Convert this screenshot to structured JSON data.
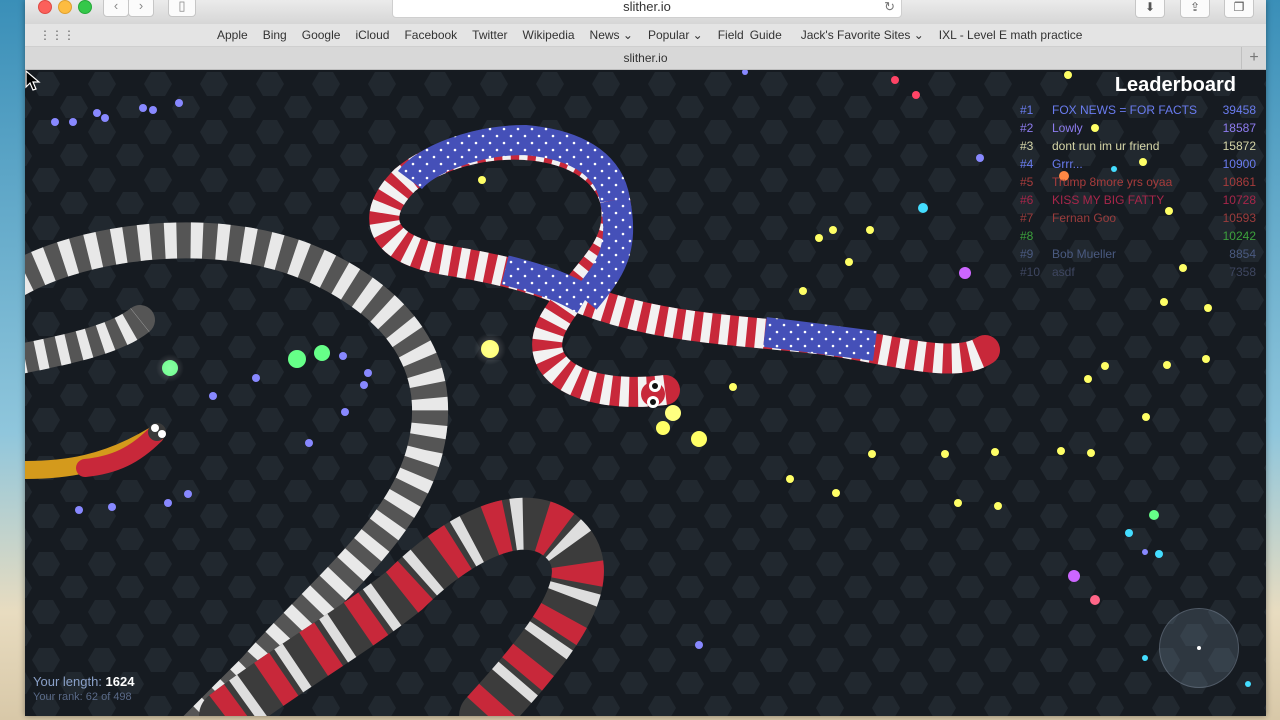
{
  "window": {
    "url": "slither.io",
    "tab_title": "slither.io",
    "colors": {
      "close": "#fc605b",
      "minimize": "#fdbc40",
      "zoom": "#34c84a"
    }
  },
  "toolbar": {
    "back_icon": "chevron-left-icon",
    "forward_icon": "chevron-right-icon",
    "sidebar_icon": "sidebar-icon",
    "reload_icon": "reload-icon",
    "downloads_icon": "download-icon",
    "share_icon": "share-icon",
    "tabs_icon": "tabs-icon"
  },
  "bookmarks": {
    "grid_icon": "grid-icon",
    "items": [
      {
        "label": "Apple"
      },
      {
        "label": "Bing"
      },
      {
        "label": "Google"
      },
      {
        "label": "iCloud"
      },
      {
        "label": "Facebook"
      },
      {
        "label": "Twitter"
      },
      {
        "label": "Wikipedia"
      },
      {
        "label": "News ⌄"
      },
      {
        "label": "Popular ⌄"
      },
      {
        "label": "Field"
      },
      {
        "label": "Guide"
      },
      {
        "label": "Jack's Favorite Sites ⌄"
      },
      {
        "label": "IXL - Level E math practice"
      }
    ]
  },
  "game": {
    "leaderboard": {
      "title": "Leaderboard",
      "rows": [
        {
          "rank": "#1",
          "name": "FOX NEWS = FOR FACTS",
          "score": "39458",
          "color": "#6a7cf0"
        },
        {
          "rank": "#2",
          "name": "Lowly",
          "score": "18587",
          "color": "#8e7cf0"
        },
        {
          "rank": "#3",
          "name": "dont run im ur friend",
          "score": "15872",
          "color": "#d6d6a8"
        },
        {
          "rank": "#4",
          "name": "Grrr...",
          "score": "10900",
          "color": "#6a7cf0"
        },
        {
          "rank": "#5",
          "name": "Trump 8more yrs oyaa",
          "score": "10861",
          "color": "#a83c3c"
        },
        {
          "rank": "#6",
          "name": "KISS MY BIG FATTY",
          "score": "10728",
          "color": "#a8264a"
        },
        {
          "rank": "#7",
          "name": "Fernan Goo",
          "score": "10593",
          "color": "#9c3c3c"
        },
        {
          "rank": "#8",
          "name": "",
          "score": "10242",
          "color": "#3ca03c"
        },
        {
          "rank": "#9",
          "name": "Bob Mueller",
          "score": "8854",
          "color": "#4a5a80"
        },
        {
          "rank": "#10",
          "name": "asdf",
          "score": "7358",
          "color": "#3e4660"
        }
      ]
    },
    "your_length_label": "Your length:",
    "your_length_value": "1624",
    "your_rank_text": "Your rank: 62 of 498",
    "minimap_icon": "minimap-icon",
    "cursor_icon": "pointer-cursor-icon"
  }
}
